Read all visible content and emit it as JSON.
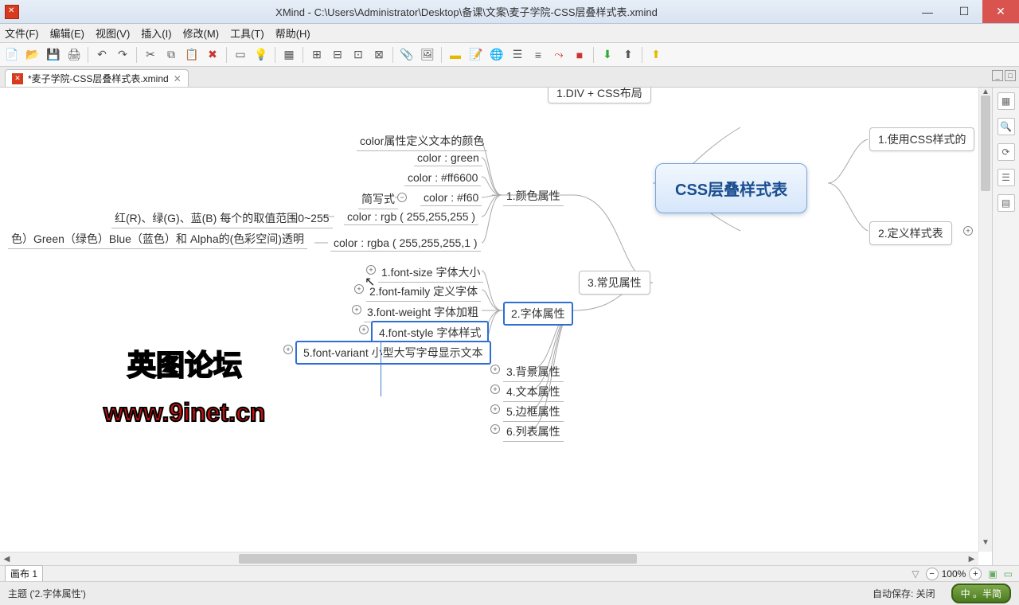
{
  "window": {
    "title": "XMind - C:\\Users\\Administrator\\Desktop\\备课\\文案\\麦子学院-CSS层叠样式表.xmind"
  },
  "menu": {
    "file": "文件(F)",
    "edit": "编辑(E)",
    "view": "视图(V)",
    "insert": "插入(I)",
    "modify": "修改(M)",
    "tools": "工具(T)",
    "help": "帮助(H)"
  },
  "tab": {
    "name": "*麦子学院-CSS层叠样式表.xmind"
  },
  "nodes": {
    "root": "CSS层叠样式表",
    "top_partial": "1.DIV + CSS布局",
    "right1": "1.使用CSS样式的",
    "right2": "2.定义样式表",
    "common_attrs": "3.常见属性",
    "color_attr": "1.颜色属性",
    "font_attr": "2.字体属性",
    "bg_attr": "3.背景属性",
    "text_attr": "4.文本属性",
    "border_attr": "5.边框属性",
    "list_attr": "6.列表属性",
    "color_defines": "color属性定义文本的颜色",
    "c_green": "color : green",
    "c_ff6600": "color : #ff6600",
    "shortform": "简写式",
    "c_f60": "color : #f60",
    "rgb_range": "红(R)、绿(G)、蓝(B) 每个的取值范围0~255",
    "c_rgb": "color : rgb ( 255,255,255 )",
    "alpha_desc": "色）Green（绿色）Blue（蓝色）和 Alpha的(色彩空间)透明",
    "c_rgba": "color : rgba ( 255,255,255,1 )",
    "f1": "1.font-size 字体大小",
    "f2": "2.font-family 定义字体",
    "f3": "3.font-weight 字体加粗",
    "f4": "4.font-style 字体样式",
    "f5": "5.font-variant 小型大写字母显示文本"
  },
  "watermark": {
    "line1": "英图论坛",
    "line2": "www.9inet.cn"
  },
  "sheet": {
    "name": "画布 1",
    "zoom": "100%"
  },
  "status": {
    "topic": "主题 ('2.字体属性')",
    "autosave": "自动保存: 关闭",
    "ime": "中 。半简"
  }
}
